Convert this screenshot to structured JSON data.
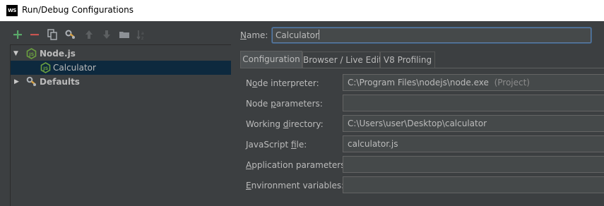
{
  "window": {
    "app_icon_text": "WS",
    "title": "Run/Debug Configurations"
  },
  "toolbar": {
    "icons": [
      "add-icon",
      "remove-icon",
      "copy-icon",
      "edit-defaults-icon",
      "move-up-icon",
      "move-down-icon",
      "folder-icon",
      "sort-icon"
    ]
  },
  "tree": {
    "nodejs": {
      "label": "Node.js",
      "expanded": true
    },
    "calculator": {
      "label": "Calculator",
      "selected": true
    },
    "defaults": {
      "label": "Defaults",
      "expanded": false
    }
  },
  "name_field": {
    "label_mnemonic": "N",
    "label_rest": "ame:",
    "value": "Calculator"
  },
  "tabs": [
    {
      "label": "Configuration",
      "active": true
    },
    {
      "label": "Browser / Live Edit",
      "active": false
    },
    {
      "label": "V8 Profiling",
      "active": false
    }
  ],
  "form": {
    "node_interpreter": {
      "label_pre": "N",
      "label_mn": "o",
      "label_post": "de interpreter:",
      "value": "C:\\Program Files\\nodejs\\node.exe",
      "suffix": "(Project)"
    },
    "node_parameters": {
      "label_pre": "Node ",
      "label_mn": "p",
      "label_post": "arameters:",
      "value": ""
    },
    "working_directory": {
      "label_pre": "Working ",
      "label_mn": "d",
      "label_post": "irectory:",
      "value": "C:\\Users\\user\\Desktop\\calculator"
    },
    "javascript_file": {
      "label_pre": "JavaScript ",
      "label_mn": "f",
      "label_post": "ile:",
      "value": "calculator.js"
    },
    "application_parameters": {
      "label_pre": "",
      "label_mn": "A",
      "label_post": "pplication parameters:",
      "value": ""
    },
    "environment_variables": {
      "label_pre": "",
      "label_mn": "E",
      "label_post": "nvironment variables:",
      "value": ""
    }
  },
  "colors": {
    "panel_bg": "#3c3f41",
    "selection_bg": "#0d293e",
    "field_bg": "#45494a",
    "focus_border": "#5f7ca3",
    "add_green": "#59a869",
    "remove_orange": "#c75450",
    "nodejs_green": "#6a9e3f"
  }
}
